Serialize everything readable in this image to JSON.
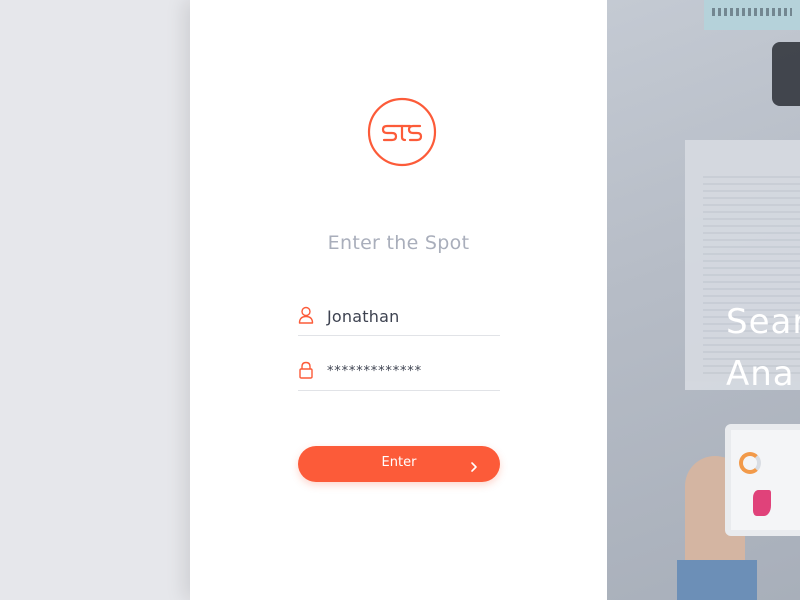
{
  "login": {
    "title": "Enter the Spot",
    "username_value": "Jonathan",
    "password_value": "*************",
    "enter_label": "Enter"
  },
  "icons": {
    "logo": "sts-logo",
    "user": "user-icon",
    "password": "lock-icon",
    "enter_arrow": "chevron-right-icon"
  },
  "hero": {
    "line1": "Sear",
    "line2": "Ana"
  },
  "colors": {
    "accent": "#fc5b39",
    "title_text": "#a9aebb",
    "field_text": "#3d4250",
    "background": "#e6e7eb"
  }
}
